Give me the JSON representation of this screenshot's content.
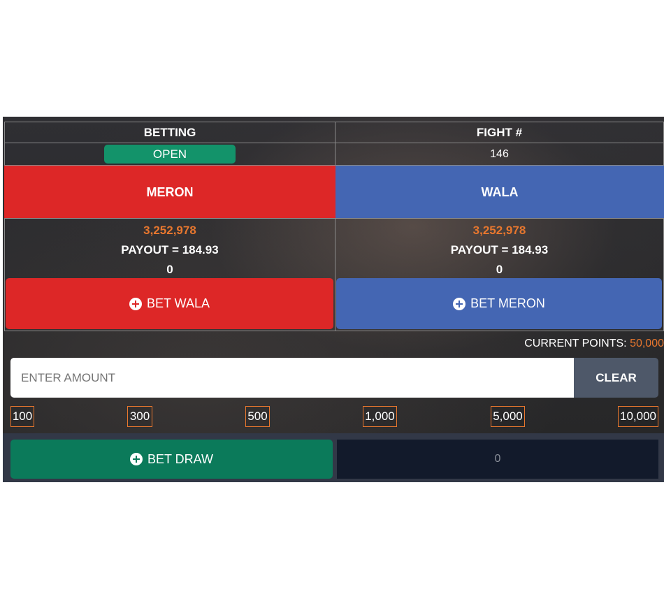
{
  "header": {
    "betting_label": "BETTING",
    "fight_label": "FIGHT #",
    "betting_status": "OPEN",
    "fight_number": "146"
  },
  "meron": {
    "label": "MERON",
    "amount": "3,252,978",
    "payout": "PAYOUT = 184.93",
    "bet": "0",
    "button_label": "BET WALA",
    "color": "#dd2727"
  },
  "wala": {
    "label": "WALA",
    "amount": "3,252,978",
    "payout": "PAYOUT = 184.93",
    "bet": "0",
    "button_label": "BET MERON",
    "color": "#4466b3"
  },
  "points": {
    "label": "CURRENT POINTS:",
    "value": "50,000"
  },
  "amount_input": {
    "placeholder": "ENTER AMOUNT",
    "value": ""
  },
  "clear_label": "CLEAR",
  "chips": [
    "100",
    "300",
    "500",
    "1,000",
    "5,000",
    "10,000"
  ],
  "draw": {
    "button_label": "BET DRAW",
    "value": "0",
    "color": "#0b7a5a"
  }
}
